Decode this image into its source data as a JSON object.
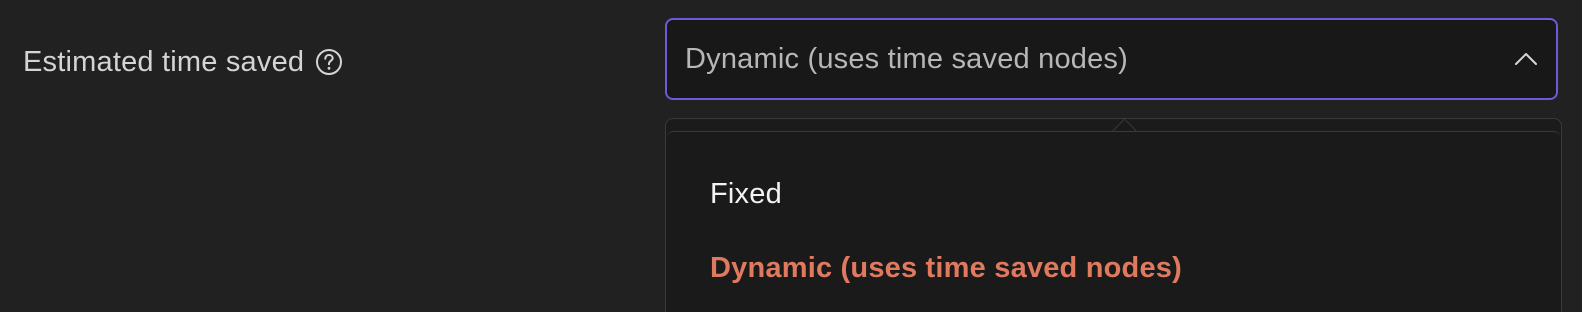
{
  "field": {
    "label": "Estimated time saved",
    "help_icon": "question-circle-icon"
  },
  "select": {
    "value": "Dynamic (uses time saved nodes)",
    "chevron_icon": "chevron-up-icon",
    "border_color": "#6b5bd6",
    "options": [
      {
        "label": "Fixed",
        "selected": false
      },
      {
        "label": "Dynamic (uses time saved nodes)",
        "selected": true
      }
    ]
  },
  "colors": {
    "background": "#212121",
    "selected_option": "#e07a5f",
    "text": "#d4d4d4"
  }
}
